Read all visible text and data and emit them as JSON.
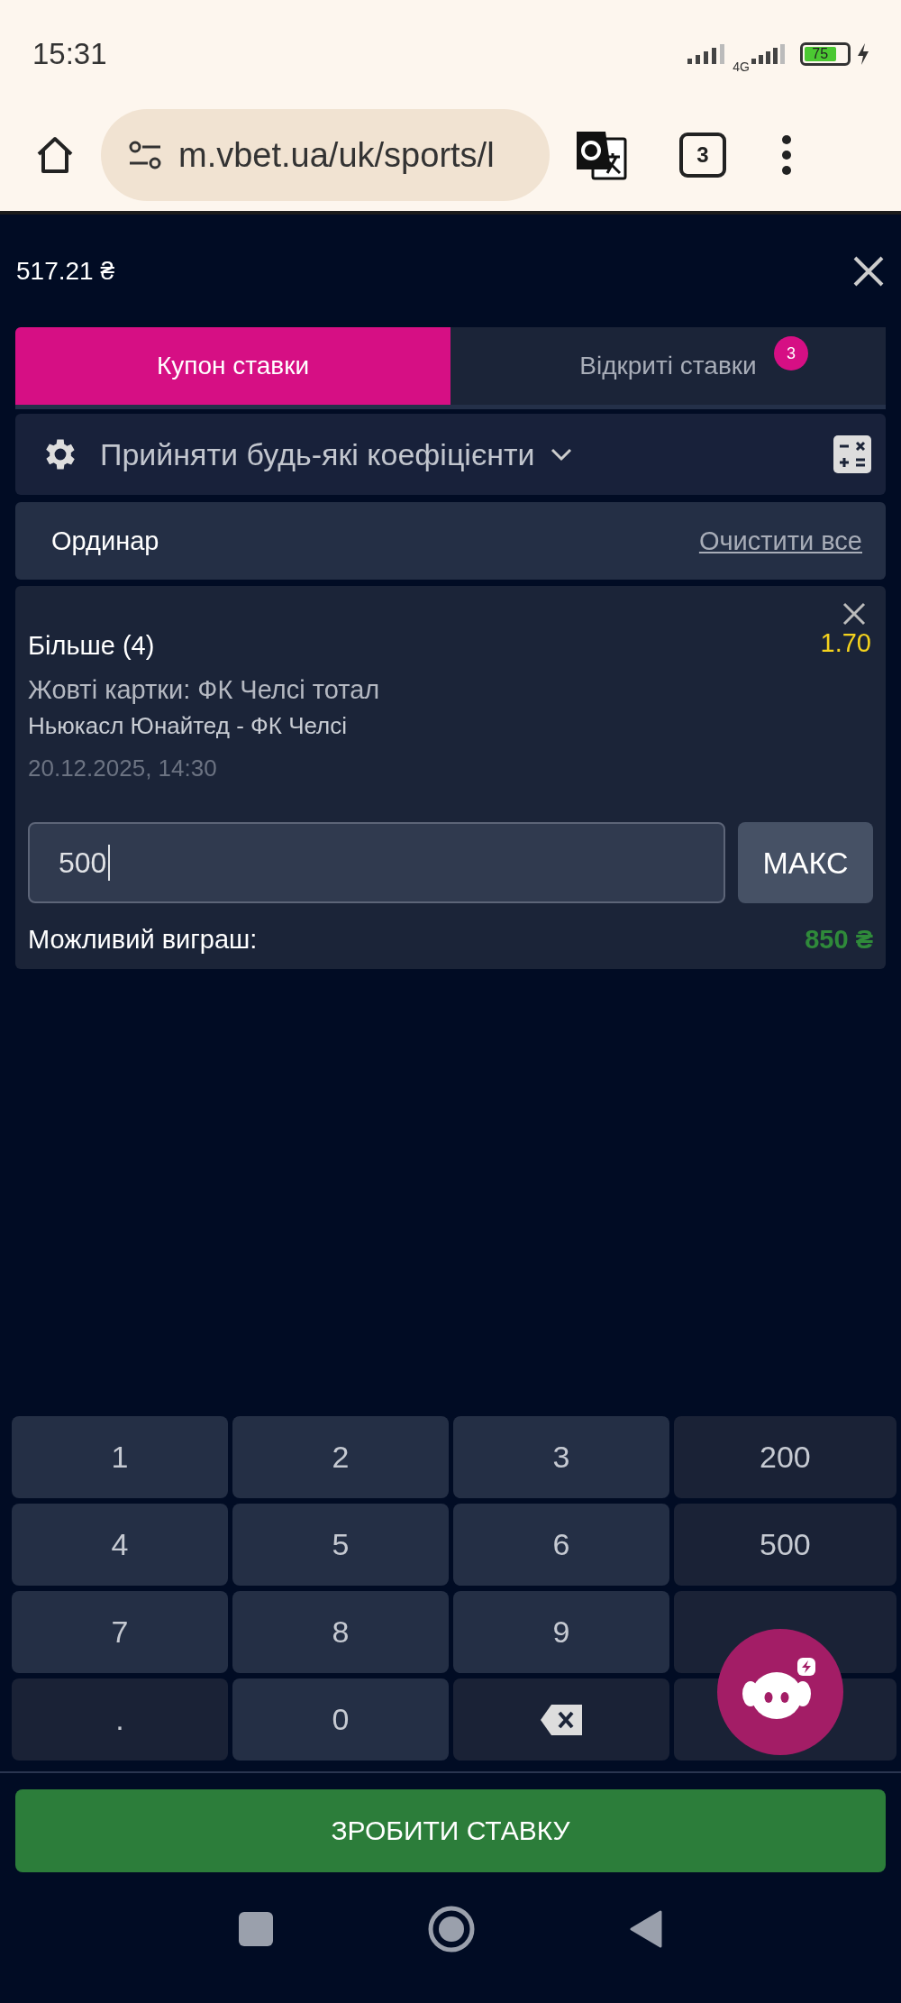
{
  "status_bar": {
    "time": "15:31",
    "network": "4G",
    "battery": "75",
    "charging": true
  },
  "browser": {
    "url": "m.vbet.ua/uk/sports/l",
    "tab_count": "3"
  },
  "balance": "517.21 ₴",
  "tabs": [
    {
      "label": "Купон ставки",
      "selected": true
    },
    {
      "label": "Відкриті ставки",
      "selected": false,
      "badge": "3"
    }
  ],
  "odds_setting": {
    "label": "Прийняти будь-які коефіцієнти"
  },
  "bet_type": {
    "label": "Ординар",
    "clear_link": "Очистити все"
  },
  "bet": {
    "selection": "Більше (4)",
    "odds": "1.70",
    "market": "Жовті картки: ФК Челсі тотал",
    "event": "Ньюкасл Юнайтед - ФК Челсі",
    "datetime": "20.12.2025, 14:30",
    "stake": "500",
    "max_button": "МАКС",
    "win_label": "Можливий виграш:",
    "win_amount": "850 ₴"
  },
  "keypad": [
    {
      "kind": "digit",
      "label": "1"
    },
    {
      "kind": "digit",
      "label": "2"
    },
    {
      "kind": "digit",
      "label": "3"
    },
    {
      "kind": "preset",
      "label": "200"
    },
    {
      "kind": "digit",
      "label": "4"
    },
    {
      "kind": "digit",
      "label": "5"
    },
    {
      "kind": "digit",
      "label": "6"
    },
    {
      "kind": "preset",
      "label": "500"
    },
    {
      "kind": "digit",
      "label": "7"
    },
    {
      "kind": "digit",
      "label": "8"
    },
    {
      "kind": "digit",
      "label": "9"
    },
    {
      "kind": "preset"
    },
    {
      "kind": "dot",
      "label": "."
    },
    {
      "kind": "digit",
      "label": "0"
    },
    {
      "kind": "backspace"
    },
    {
      "kind": "preset"
    }
  ],
  "place_bet_button": "ЗРОБИТИ СТАВКУ"
}
